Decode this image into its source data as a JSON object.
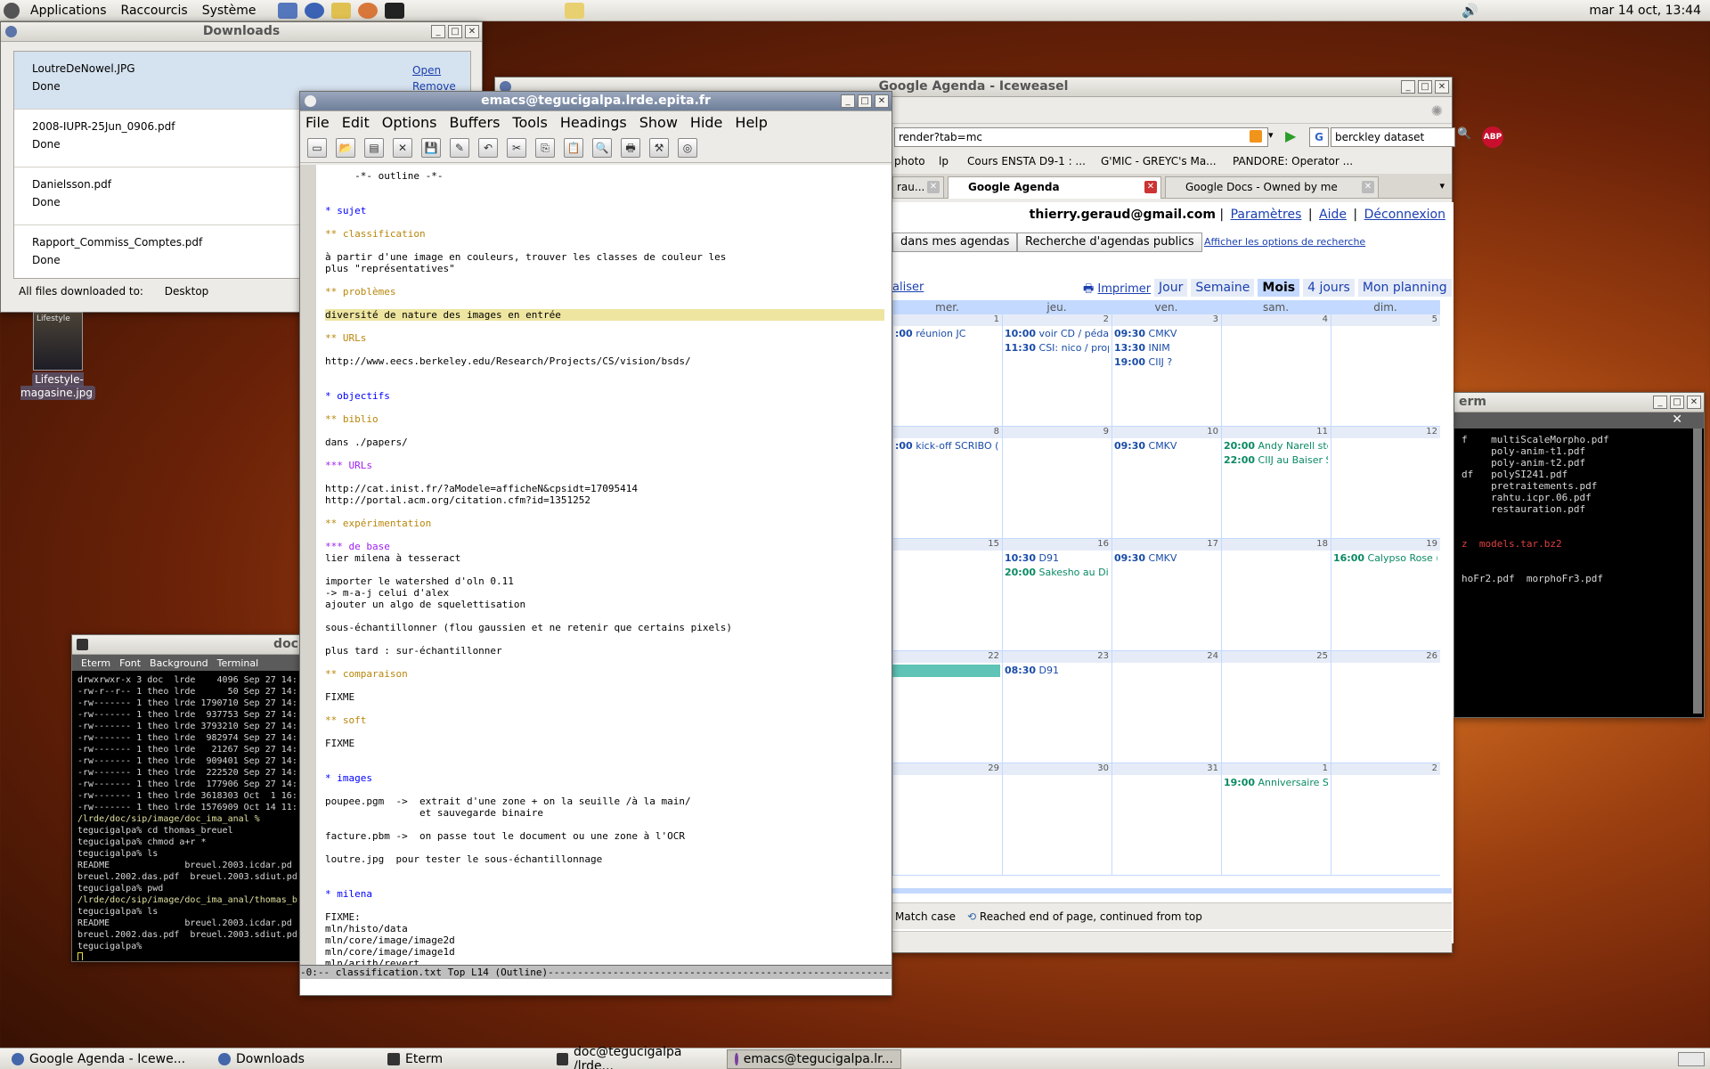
{
  "top_panel": {
    "menus": [
      "Applications",
      "Raccourcis",
      "Système"
    ],
    "clock": "mar 14 oct, 13:44"
  },
  "downloads": {
    "title": "Downloads",
    "items": [
      {
        "name": "LoutreDeNowel.JPG",
        "status": "Done",
        "open": "Open",
        "remove": "Remove"
      },
      {
        "name": "2008-IUPR-25Jun_0906.pdf",
        "status": "Done"
      },
      {
        "name": "Danielsson.pdf",
        "status": "Done"
      },
      {
        "name": "Rapport_Commiss_Comptes.pdf",
        "status": "Done"
      }
    ],
    "footer_label": "All files downloaded to:",
    "footer_folder": "Desktop"
  },
  "desktop_icon": {
    "label": "Lifestyle-magasine.jpg",
    "thumb_text": "Lifestyle"
  },
  "eterm_left": {
    "title": "doc",
    "menus": [
      "Eterm",
      "Font",
      "Background",
      "Terminal"
    ],
    "lines": [
      "drwxrwxr-x 3 doc  lrde    4096 Sep 27 14:",
      "-rw-r--r-- 1 theo lrde      50 Sep 27 14:",
      "-rw------- 1 theo lrde 1790710 Sep 27 14:",
      "-rw------- 1 theo lrde  937753 Sep 27 14:",
      "-rw------- 1 theo lrde 3793210 Sep 27 14:",
      "-rw------- 1 theo lrde  982974 Sep 27 14:",
      "-rw------- 1 theo lrde   21267 Sep 27 14:",
      "-rw------- 1 theo lrde  909401 Sep 27 14:",
      "-rw------- 1 theo lrde  222520 Sep 27 14:",
      "-rw------- 1 theo lrde  177906 Sep 27 14:",
      "-rw------- 1 theo lrde 3618303 Oct  1 16:",
      "-rw------- 1 theo lrde 1576909 Oct 14 11:",
      "/lrde/doc/sip/image/doc_ima_anal %",
      "tegucigalpa% cd thomas_breuel",
      "tegucigalpa% chmod a+r *",
      "tegucigalpa% ls",
      "README              breuel.2003.icdar.pd",
      "breuel.2002.das.pdf  breuel.2003.sdiut.pd",
      "tegucigalpa% pwd",
      "/lrde/doc/sip/image/doc_ima_anal/thomas_b",
      "tegucigalpa% ls",
      "README              breuel.2003.icdar.pd",
      "breuel.2002.das.pdf  breuel.2003.sdiut.pd",
      "tegucigalpa% "
    ]
  },
  "eterm_right": {
    "title": "erm",
    "lines": [
      "f    multiScaleMorpho.pdf",
      "     poly-anim-t1.pdf",
      "     poly-anim-t2.pdf",
      "df   polySI241.pdf",
      "     pretraitements.pdf",
      "     rahtu.icpr.06.pdf",
      "     restauration.pdf",
      "",
      "",
      "z  models.tar.bz2",
      "",
      "",
      "hoFr2.pdf  morphoFr3.pdf"
    ]
  },
  "browser": {
    "title": "Google Agenda - Iceweasel",
    "url": "render?tab=mc",
    "search_value": "berckley dataset",
    "bookmarks": [
      "photo",
      "lp",
      "Cours ENSTA D9-1 : ...",
      "G'MIC - GREYC's Ma...",
      "PANDORE: Operator ..."
    ],
    "tabs": [
      "rau...",
      "Google Agenda",
      "Google Docs - Owned by me"
    ],
    "user_email": "thierry.geraud@gmail.com",
    "user_links": [
      "Paramètres",
      "Aide",
      "Déconnexion"
    ],
    "btn_my_agendas": "dans mes agendas",
    "btn_public": "Recherche d'agendas publics",
    "search_options": "Afficher les options de recherche",
    "partial_link": "aliser",
    "print": "Imprimer",
    "views": [
      "Jour",
      "Semaine",
      "Mois",
      "4 jours",
      "Mon planning"
    ],
    "current_view": "Mois",
    "day_heads": [
      "mer.",
      "jeu.",
      "ven.",
      "sam.",
      "dim."
    ],
    "weeks": [
      {
        "days": [
          "1",
          "2",
          "3",
          "4",
          "5"
        ]
      },
      {
        "days": [
          "8",
          "9",
          "10",
          "11",
          "12"
        ]
      },
      {
        "days": [
          "15",
          "16",
          "17",
          "18",
          "19"
        ]
      },
      {
        "days": [
          "22",
          "23",
          "24",
          "25",
          "26"
        ]
      },
      {
        "days": [
          "29",
          "30",
          "31",
          "1",
          "2"
        ]
      }
    ],
    "events": [
      {
        "w": 0,
        "d": 0,
        "i": 0,
        "time": ":00",
        "text": "réunion JC",
        "green": false
      },
      {
        "w": 0,
        "d": 1,
        "i": 0,
        "time": "10:00",
        "text": "voir CD / pédago d",
        "green": false
      },
      {
        "w": 0,
        "d": 1,
        "i": 1,
        "time": "11:30",
        "text": "CSI: nico / props",
        "green": false
      },
      {
        "w": 0,
        "d": 2,
        "i": 0,
        "time": "09:30",
        "text": "CMKV",
        "green": false
      },
      {
        "w": 0,
        "d": 2,
        "i": 1,
        "time": "13:30",
        "text": "INIM",
        "green": false
      },
      {
        "w": 0,
        "d": 2,
        "i": 2,
        "time": "19:00",
        "text": "CIIJ ?",
        "green": false
      },
      {
        "w": 1,
        "d": 0,
        "i": 0,
        "time": ":00",
        "text": "kick-off SCRIBO (l",
        "green": false
      },
      {
        "w": 1,
        "d": 2,
        "i": 0,
        "time": "09:30",
        "text": "CMKV",
        "green": false
      },
      {
        "w": 1,
        "d": 3,
        "i": 0,
        "time": "20:00",
        "text": "Andy Narell steelb",
        "green": true
      },
      {
        "w": 1,
        "d": 3,
        "i": 1,
        "time": "22:00",
        "text": "CIIJ au Baiser Salé",
        "green": true
      },
      {
        "w": 2,
        "d": 1,
        "i": 0,
        "time": "10:30",
        "text": "D91",
        "green": false
      },
      {
        "w": 2,
        "d": 1,
        "i": 1,
        "time": "20:00",
        "text": "Sakesho au Divan",
        "green": true
      },
      {
        "w": 2,
        "d": 2,
        "i": 0,
        "time": "09:30",
        "text": "CMKV",
        "green": false
      },
      {
        "w": 2,
        "d": 4,
        "i": 0,
        "time": "16:00",
        "text": "Calypso Rose (por",
        "green": true
      },
      {
        "w": 3,
        "d": 1,
        "i": 0,
        "time": "08:30",
        "text": "D91",
        "green": false
      },
      {
        "w": 4,
        "d": 3,
        "i": 0,
        "time": "19:00",
        "text": "Anniversaire Stépl",
        "green": true
      }
    ],
    "find_match_case": "Match case",
    "find_status": "Reached end of page, continued from top"
  },
  "emacs": {
    "title": "emacs@tegucigalpa.lrde.epita.fr",
    "menus": [
      "File",
      "Edit",
      "Options",
      "Buffers",
      "Tools",
      "Headings",
      "Show",
      "Hide",
      "Help"
    ],
    "lines": [
      {
        "t": "     -*- outline -*-",
        "c": ""
      },
      {
        "t": "",
        "c": ""
      },
      {
        "t": "",
        "c": ""
      },
      {
        "t": "* sujet",
        "c": "h1"
      },
      {
        "t": "",
        "c": ""
      },
      {
        "t": "** classification",
        "c": "h2"
      },
      {
        "t": "",
        "c": ""
      },
      {
        "t": "à partir d'une image en couleurs, trouver les classes de couleur les",
        "c": ""
      },
      {
        "t": "plus \"représentatives\"",
        "c": ""
      },
      {
        "t": "",
        "c": ""
      },
      {
        "t": "** problèmes",
        "c": "h2"
      },
      {
        "t": "",
        "c": ""
      },
      {
        "t": "diversité de nature des images en entrée",
        "c": "hl"
      },
      {
        "t": "",
        "c": ""
      },
      {
        "t": "** URLs",
        "c": "h2"
      },
      {
        "t": "",
        "c": ""
      },
      {
        "t": "http://www.eecs.berkeley.edu/Research/Projects/CS/vision/bsds/",
        "c": ""
      },
      {
        "t": "",
        "c": ""
      },
      {
        "t": "",
        "c": ""
      },
      {
        "t": "* objectifs",
        "c": "h1"
      },
      {
        "t": "",
        "c": ""
      },
      {
        "t": "** biblio",
        "c": "h2"
      },
      {
        "t": "",
        "c": ""
      },
      {
        "t": "dans ./papers/",
        "c": ""
      },
      {
        "t": "",
        "c": ""
      },
      {
        "t": "*** URLs",
        "c": "h3"
      },
      {
        "t": "",
        "c": ""
      },
      {
        "t": "http://cat.inist.fr/?aModele=afficheN&cpsidt=17095414",
        "c": ""
      },
      {
        "t": "http://portal.acm.org/citation.cfm?id=1351252",
        "c": ""
      },
      {
        "t": "",
        "c": ""
      },
      {
        "t": "** expérimentation",
        "c": "h2"
      },
      {
        "t": "",
        "c": ""
      },
      {
        "t": "*** de base",
        "c": "h3"
      },
      {
        "t": "lier milena à tesseract",
        "c": ""
      },
      {
        "t": "",
        "c": ""
      },
      {
        "t": "importer le watershed d'oln 0.11",
        "c": ""
      },
      {
        "t": "-> m-a-j celui d'alex",
        "c": ""
      },
      {
        "t": "ajouter un algo de squelettisation",
        "c": ""
      },
      {
        "t": "",
        "c": ""
      },
      {
        "t": "sous-échantillonner (flou gaussien et ne retenir que certains pixels)",
        "c": ""
      },
      {
        "t": "",
        "c": ""
      },
      {
        "t": "plus tard : sur-échantillonner",
        "c": ""
      },
      {
        "t": "",
        "c": ""
      },
      {
        "t": "** comparaison",
        "c": "h2"
      },
      {
        "t": "",
        "c": ""
      },
      {
        "t": "FIXME",
        "c": ""
      },
      {
        "t": "",
        "c": ""
      },
      {
        "t": "** soft",
        "c": "h2"
      },
      {
        "t": "",
        "c": ""
      },
      {
        "t": "FIXME",
        "c": ""
      },
      {
        "t": "",
        "c": ""
      },
      {
        "t": "",
        "c": ""
      },
      {
        "t": "* images",
        "c": "h1"
      },
      {
        "t": "",
        "c": ""
      },
      {
        "t": "poupee.pgm  ->  extrait d'une zone + on la seuille /à la main/",
        "c": ""
      },
      {
        "t": "                et sauvegarde binaire",
        "c": ""
      },
      {
        "t": "",
        "c": ""
      },
      {
        "t": "facture.pbm ->  on passe tout le document ou une zone à l'OCR",
        "c": ""
      },
      {
        "t": "",
        "c": ""
      },
      {
        "t": "loutre.jpg  pour tester le sous-échantillonnage",
        "c": ""
      },
      {
        "t": "",
        "c": ""
      },
      {
        "t": "",
        "c": ""
      },
      {
        "t": "* milena",
        "c": "h1"
      },
      {
        "t": "",
        "c": ""
      },
      {
        "t": "FIXME:",
        "c": ""
      },
      {
        "t": "mln/histo/data",
        "c": ""
      },
      {
        "t": "mln/core/image/image2d",
        "c": ""
      },
      {
        "t": "mln/core/image/image1d",
        "c": ""
      },
      {
        "t": "mln/arith/revert",
        "c": ""
      }
    ],
    "modeline": "-0:--  classification.txt   Top L14    (Outline)-----------------------------------------------------------"
  },
  "taskbar": {
    "tasks": [
      "Google Agenda - Icewe...",
      "Downloads",
      "Eterm",
      "doc@tegucigalpa /lrde...",
      "emacs@tegucigalpa.lr..."
    ],
    "active_index": 4
  }
}
